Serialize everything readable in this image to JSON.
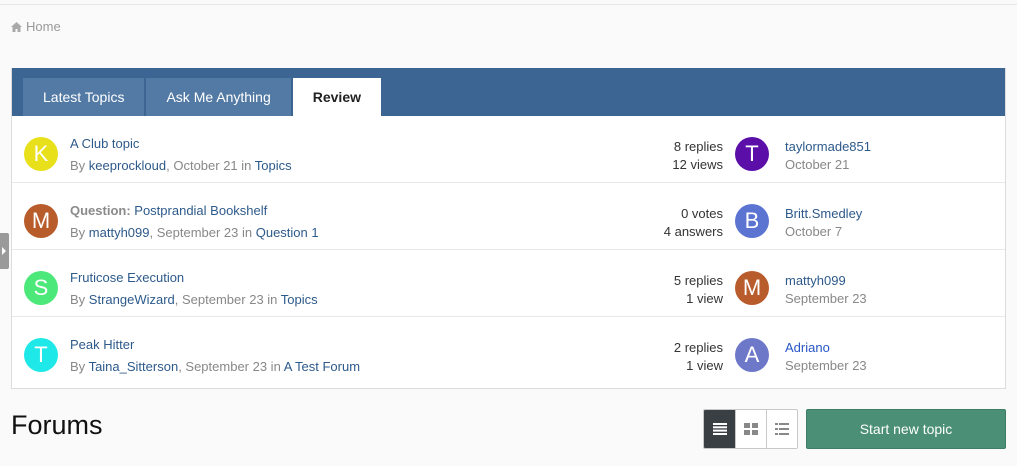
{
  "breadcrumb": {
    "home_label": "Home"
  },
  "tabs": [
    {
      "label": "Latest Topics"
    },
    {
      "label": "Ask Me Anything"
    },
    {
      "label": "Review"
    }
  ],
  "topics": [
    {
      "avatar_letter": "K",
      "avatar_color": "#e8e01a",
      "prefix": "",
      "title": "A Club topic",
      "by": "By",
      "author": "keeprockloud",
      "date": ", October 21 in ",
      "forum": "Topics",
      "stat1": "8 replies",
      "stat2": "12 views",
      "last_letter": "T",
      "last_color": "#5b0fa8",
      "last_user": "taylormade851",
      "last_date": "October 21"
    },
    {
      "avatar_letter": "M",
      "avatar_color": "#b85c2b",
      "prefix": "Question:",
      "title": " Postprandial Bookshelf",
      "by": "By",
      "author": "mattyh099",
      "date": ", September 23 in ",
      "forum": "Question 1",
      "stat1": "0 votes",
      "stat2": "4 answers",
      "last_letter": "B",
      "last_color": "#5b74d1",
      "last_user": "Britt.Smedley",
      "last_date": "October 7"
    },
    {
      "avatar_letter": "S",
      "avatar_color": "#4de87a",
      "prefix": "",
      "title": "Fruticose Execution",
      "by": "By",
      "author": "StrangeWizard",
      "date": ", September 23 in ",
      "forum": "Topics",
      "stat1": "5 replies",
      "stat2": "1 view",
      "last_letter": "M",
      "last_color": "#b85c2b",
      "last_user": "mattyh099",
      "last_date": "September 23"
    },
    {
      "avatar_letter": "T",
      "avatar_color": "#1ee8e8",
      "prefix": "",
      "title": "Peak Hitter",
      "by": "By",
      "author": "Taina_Sitterson",
      "date": ", September 23 in ",
      "forum": "A Test Forum",
      "stat1": "2 replies",
      "stat2": "1 view",
      "last_letter": "A",
      "last_color": "#6e78c8",
      "last_user": "Adriano",
      "last_date": "September 23"
    }
  ],
  "forums": {
    "title": "Forums",
    "start_button": "Start new topic"
  },
  "view_icons": [
    "list-view-icon",
    "grid-view-icon",
    "fluid-view-icon"
  ]
}
